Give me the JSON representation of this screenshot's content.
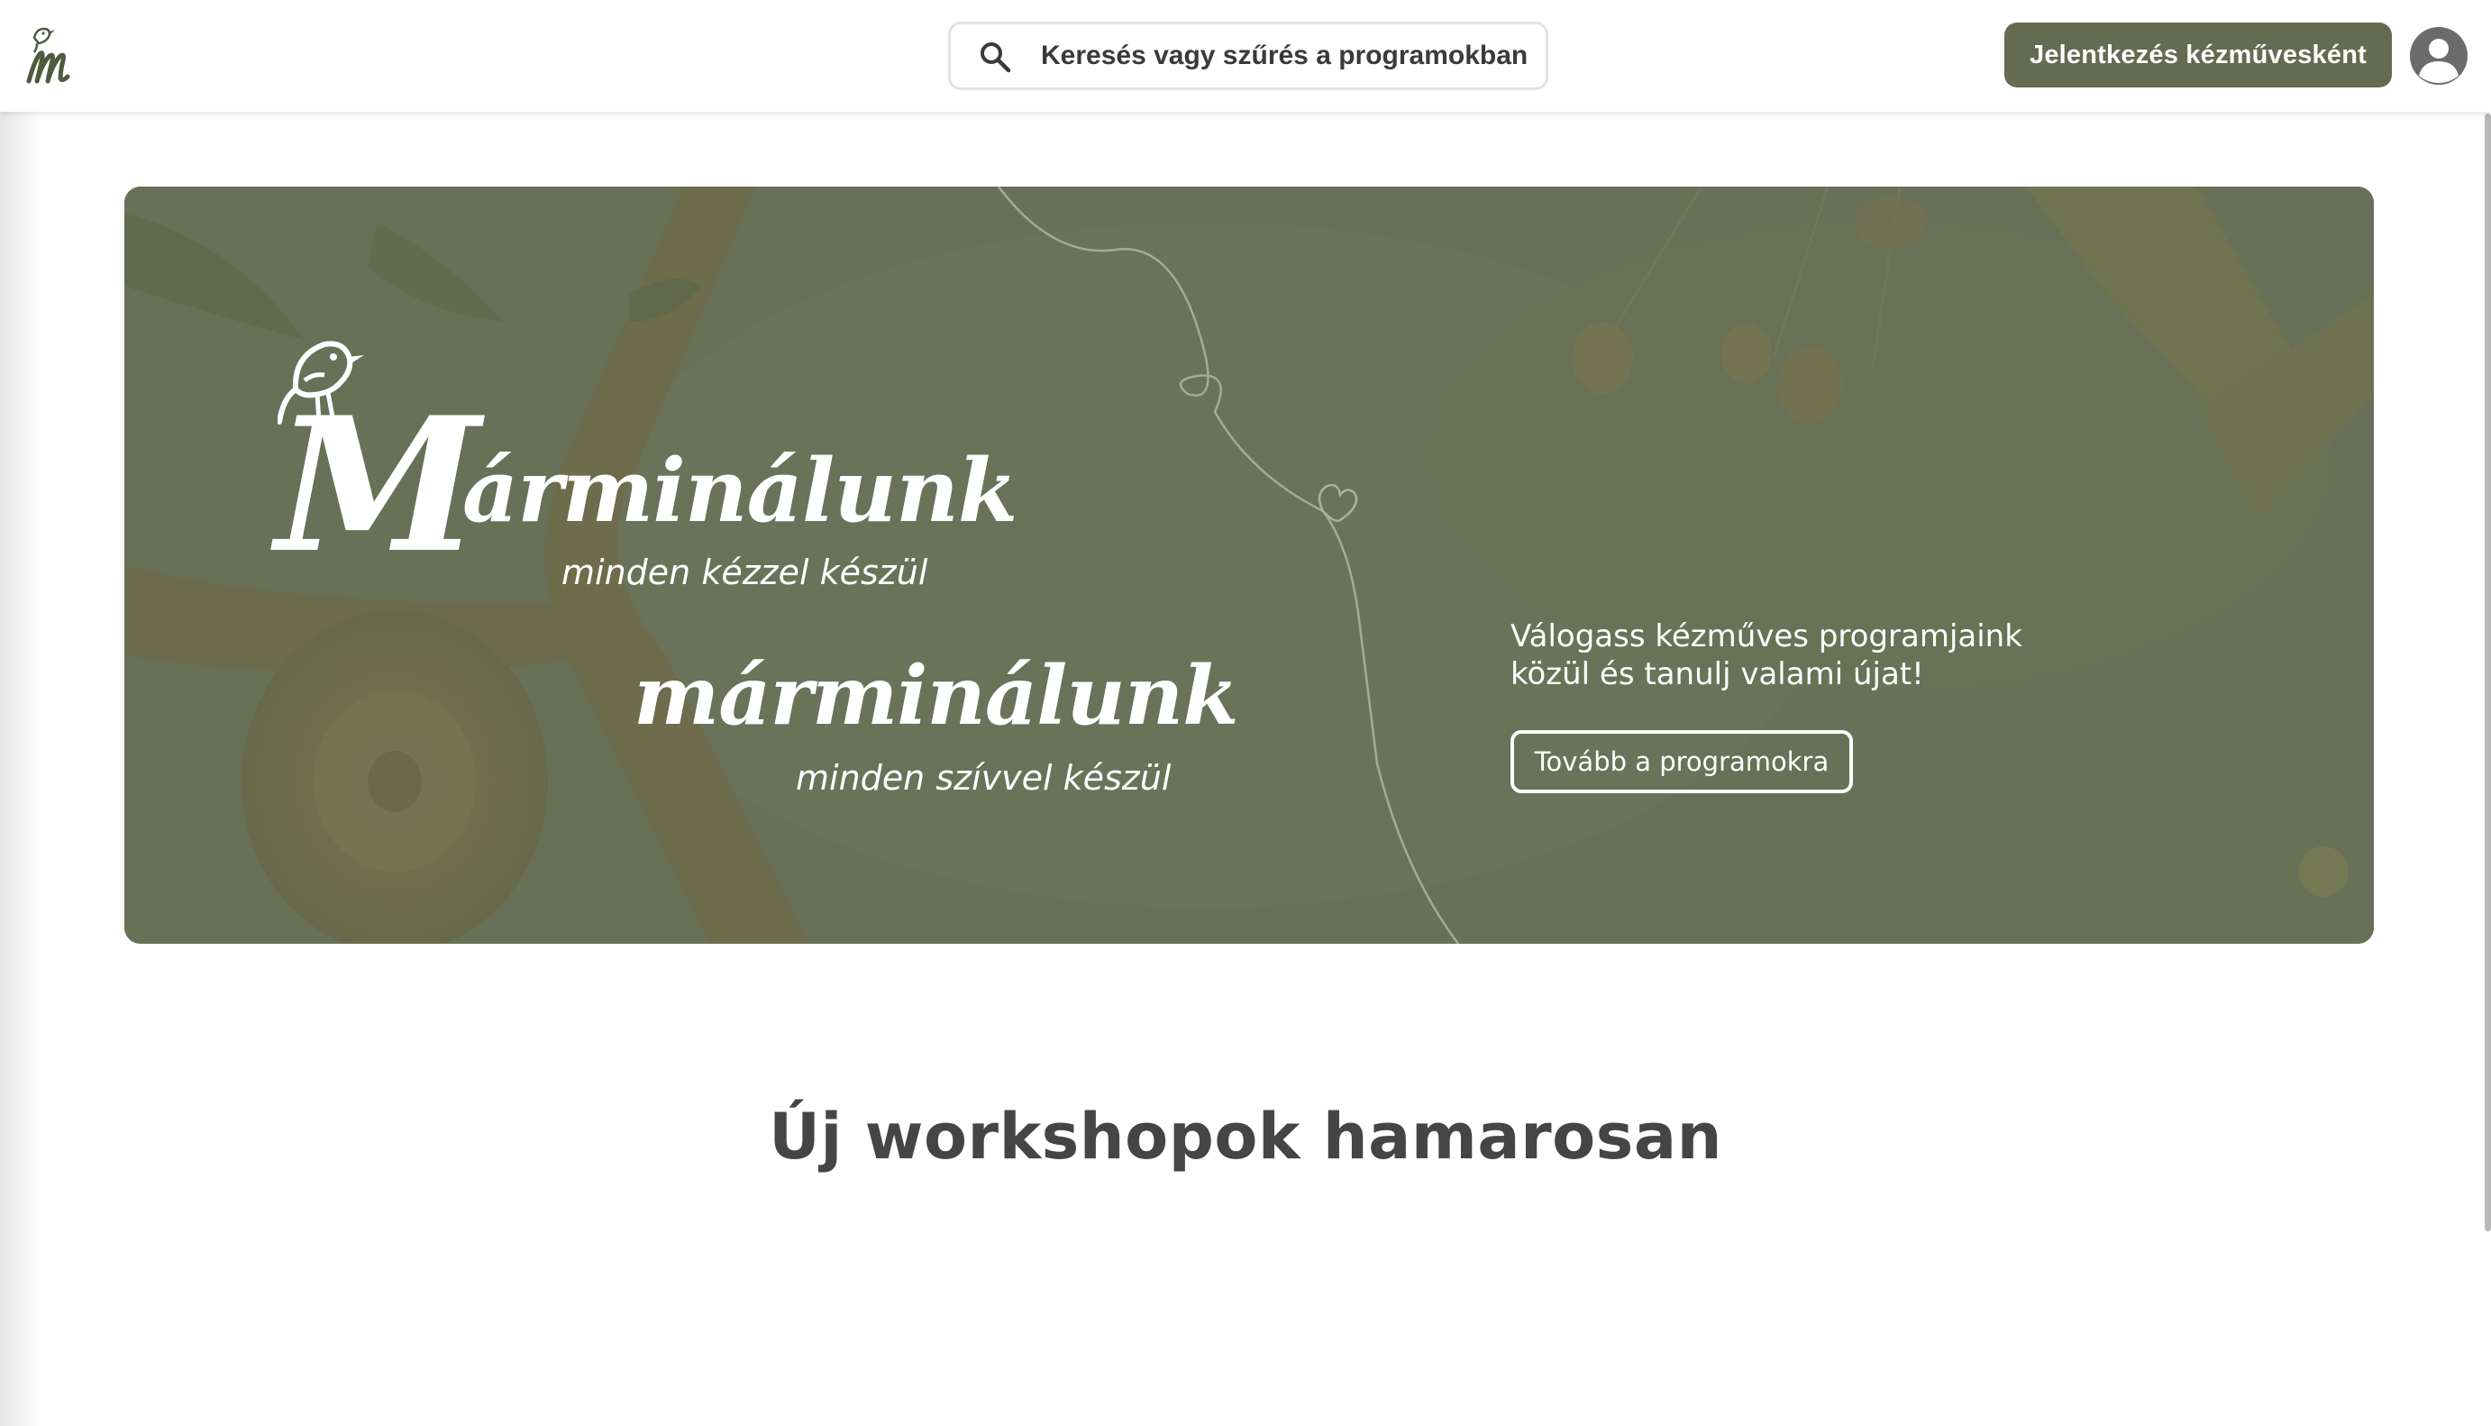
{
  "colors": {
    "brand": "#646b52",
    "hero_overlay": "#697159",
    "text_dark": "#3d3d3d"
  },
  "header": {
    "logo_icon": "marminalunk-bird-m-logo",
    "search": {
      "placeholder": "Keresés vagy szűrés a programokban",
      "icon": "search-icon"
    },
    "cta_label": "Jelentkezés kézművesként",
    "avatar_icon": "user-avatar-icon"
  },
  "hero": {
    "brand_initial": "M",
    "brand_name_primary": "árminálunk",
    "tagline_primary": "minden kézzel készül",
    "brand_name_secondary": "márminálunk",
    "tagline_secondary": "minden szívvel készül",
    "description": "Válogass kézműves programjaink közül és tanulj valami újat!",
    "button_label": "Tovább a programokra"
  },
  "main": {
    "section_title": "Új workshopok hamarosan"
  }
}
